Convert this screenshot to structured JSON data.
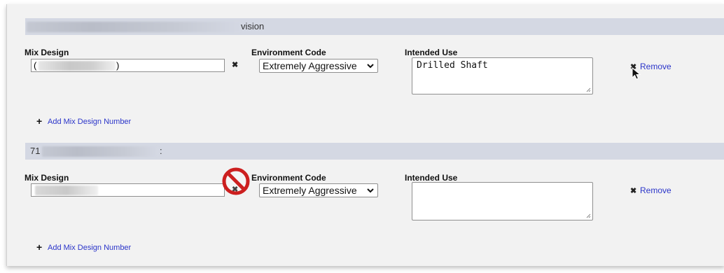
{
  "section1": {
    "header_text": "vision",
    "mix_design_label": "Mix Design",
    "mix_design_value_prefix": "(",
    "mix_design_value_suffix": ")",
    "environment_code_label": "Environment Code",
    "environment_code_value": "Extremely Aggressive",
    "intended_use_label": "Intended Use",
    "intended_use_value": "Drilled Shaft",
    "remove_label": "Remove",
    "add_label": "Add Mix Design Number"
  },
  "section2": {
    "header_text": "71",
    "header_suffix": ":",
    "mix_design_label": "Mix Design",
    "environment_code_label": "Environment Code",
    "environment_code_value": "Extremely Aggressive",
    "intended_use_label": "Intended Use",
    "intended_use_value": "",
    "remove_label": "Remove",
    "add_label": "Add Mix Design Number"
  },
  "icons": {
    "clear": "close-icon",
    "remove": "close-icon",
    "add": "plus-icon",
    "no_symbol": "prohibited-icon",
    "cursor": "mouse-pointer-icon"
  },
  "colors": {
    "header_bg": "#d4d8e3",
    "link": "#2b35c9",
    "prohibited": "#cc1f1f"
  }
}
